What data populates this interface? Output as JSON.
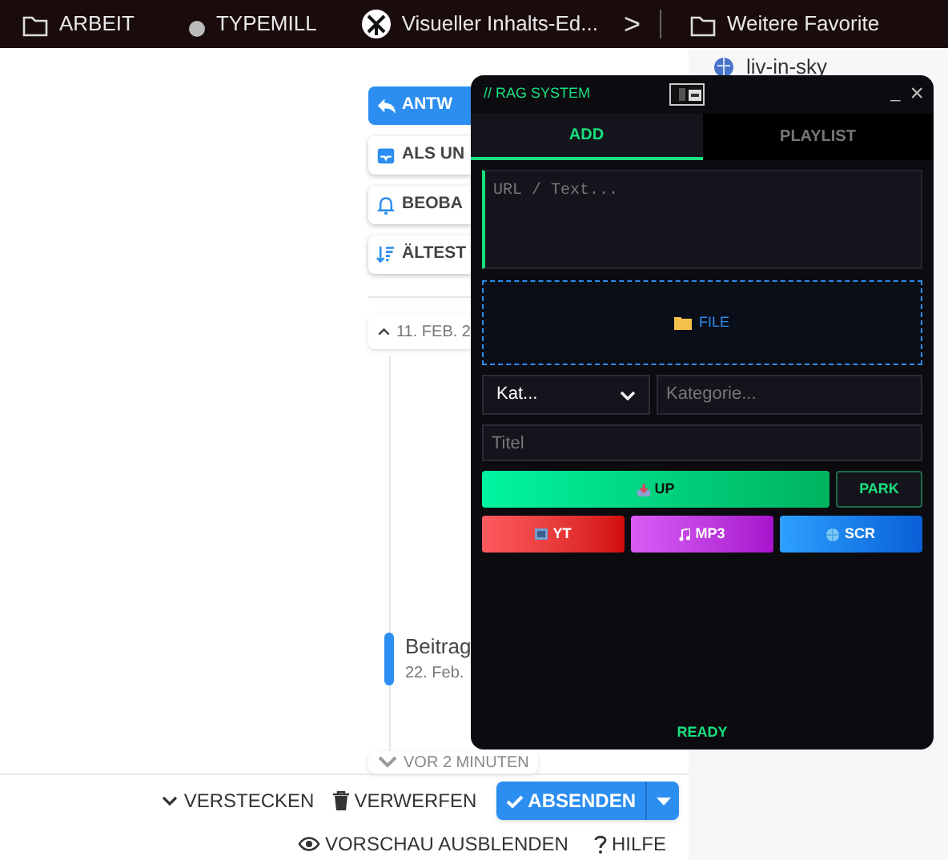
{
  "bookmarks_bar": {
    "items": [
      {
        "kind": "folder",
        "label": "ARBEIT"
      },
      {
        "kind": "site",
        "label": "TYPEMILL"
      },
      {
        "kind": "app",
        "label": "Visueller Inhalts-Ed..."
      },
      {
        "kind": "more",
        "label": ">"
      },
      {
        "kind": "folder",
        "label": "Weitere Favorite"
      }
    ]
  },
  "page": {
    "actions": [
      {
        "kind": "primary",
        "label": "ANTW"
      },
      {
        "kind": "default",
        "label": "ALS UN"
      },
      {
        "kind": "default",
        "label": "BEOBA"
      },
      {
        "kind": "default",
        "label": "ÄLTEST"
      }
    ],
    "timeline_top": "11. FEB. 2",
    "post": {
      "title": "Beitrag",
      "date": "22. Feb."
    },
    "timeline_bottom": "VOR 2 MINUTEN",
    "footer": {
      "hide": "VERSTECKEN",
      "discard": "VERWERFEN",
      "submit": "ABSENDEN",
      "preview": "VORSCHAU AUSBLENDEN",
      "help": "HILFE"
    }
  },
  "sidebar": {
    "item": "liv-in-sky"
  },
  "panel": {
    "title": "// RAG SYSTEM",
    "minimize": "_",
    "close": "×",
    "tabs": [
      {
        "label": "ADD",
        "selected": true
      },
      {
        "label": "PLAYLIST",
        "selected": false
      }
    ],
    "text_placeholder": "URL / Text...",
    "file_label": "FILE",
    "category_select": "Kat...",
    "category_placeholder": "Kategorie...",
    "title_placeholder": "Titel",
    "upload": "UP",
    "park": "PARK",
    "sources": [
      {
        "kind": "yt",
        "label": "YT"
      },
      {
        "kind": "mp3",
        "label": "MP3"
      },
      {
        "kind": "scr",
        "label": "SCR"
      }
    ],
    "status": "READY"
  }
}
